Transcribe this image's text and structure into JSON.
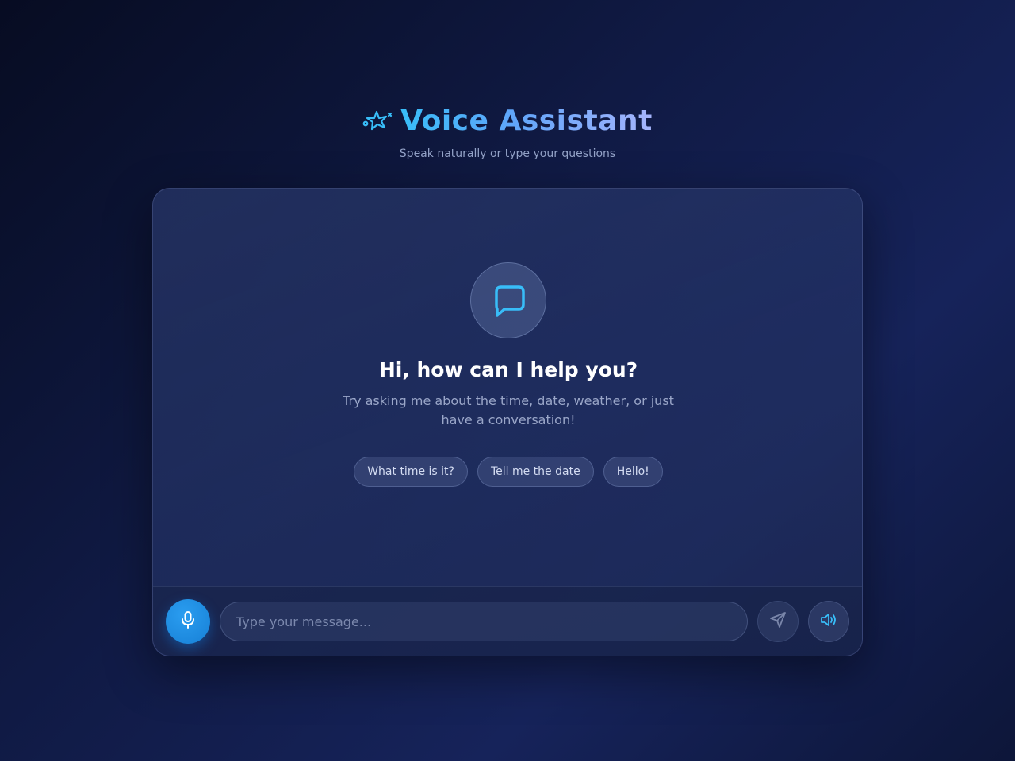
{
  "header": {
    "title": "Voice Assistant",
    "subtitle": "Speak naturally or type your questions",
    "icon": "sparkle-icon"
  },
  "welcome": {
    "icon": "chat-bubble-icon",
    "title": "Hi, how can I help you?",
    "text": "Try asking me about the time, date, weather, or just have a conversation!",
    "suggestions": [
      "What time is it?",
      "Tell me the date",
      "Hello!"
    ]
  },
  "input_bar": {
    "mic_icon": "microphone-icon",
    "placeholder": "Type your message...",
    "value": "",
    "send_icon": "send-icon",
    "speaker_icon": "speaker-icon"
  },
  "colors": {
    "accent": "#38bdf8",
    "mic_button": "#1e88e5",
    "title_gradient_end": "#a5b4fc"
  }
}
